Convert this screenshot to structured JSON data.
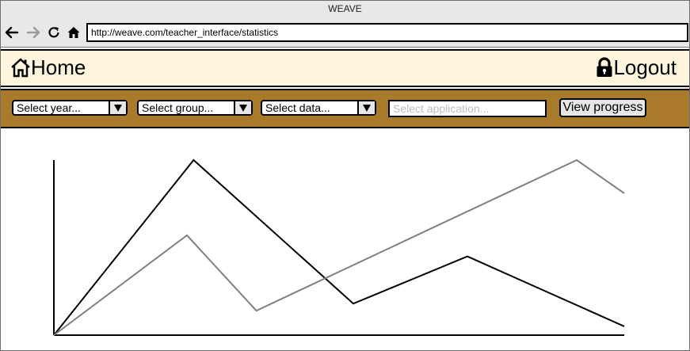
{
  "window": {
    "title": "WEAVE"
  },
  "browser": {
    "url": "http://weave.com/teacher_interface/statistics"
  },
  "header": {
    "home_label": "Home",
    "logout_label": "Logout"
  },
  "filters": {
    "year": {
      "selected": "Select year..."
    },
    "group": {
      "selected": "Select group..."
    },
    "data": {
      "selected": "Select data..."
    },
    "application": {
      "value": "",
      "placeholder": "Select application..."
    },
    "view_progress_label": "View progress"
  },
  "colors": {
    "header_bg": "#fff4dc",
    "toolbar_bg": "#a87a2a"
  },
  "chart_data": {
    "type": "line",
    "x": [
      0,
      1,
      2,
      3,
      4,
      5,
      6
    ],
    "xlim": [
      0,
      6
    ],
    "ylim": [
      0,
      100
    ],
    "grid": false,
    "legend": "none",
    "series": [
      {
        "color": "#000000",
        "x": [
          0,
          1.47,
          3.15,
          4.35,
          6
        ],
        "values": [
          0,
          100,
          18,
          45,
          5
        ]
      },
      {
        "color": "#7f7f7f",
        "x": [
          0,
          1.4,
          2.13,
          5.5,
          6
        ],
        "values": [
          0,
          57,
          14,
          100,
          81
        ]
      }
    ]
  }
}
